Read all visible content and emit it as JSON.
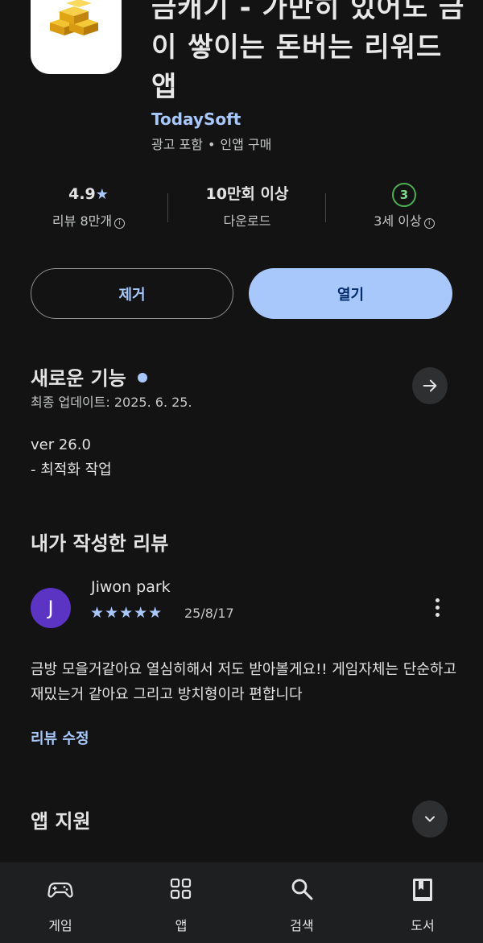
{
  "app": {
    "title": "금캐기 - 가만히 있어도 금이 쌓이는 돈버는 리워드 앱",
    "developer": "TodaySoft",
    "meta_ads": "광고 포함",
    "meta_iap": "인앱 구매"
  },
  "stats": {
    "rating": "4.9",
    "rating_star": "★",
    "reviews": "리뷰 8만개",
    "downloads": "10만회 이상",
    "downloads_label": "다운로드",
    "age_badge": "3",
    "age_label": "3세 이상"
  },
  "actions": {
    "remove_label": "제거",
    "open_label": "열기"
  },
  "whats_new": {
    "title": "새로운 기능",
    "last_updated": "최종 업데이트: 2025. 6. 25.",
    "version": "ver 26.0",
    "note": "- 최적화 작업"
  },
  "my_review": {
    "title": "내가 작성한 리뷰",
    "avatar_initial": "J",
    "reviewer": "Jiwon park",
    "stars": "★★★★★",
    "rating": 5,
    "date": "25/8/17",
    "text": "금방 모을거같아요 열심히해서 저도 받아볼게요!! 게임자체는 단순하고 재밌는거 같아요 그리고 방치형이라 편합니다",
    "edit_label": "리뷰 수정"
  },
  "app_support": {
    "title": "앱 지원"
  },
  "bottom_nav": {
    "games": "게임",
    "apps": "앱",
    "search": "검색",
    "books": "도서"
  },
  "colors": {
    "background": "#131314",
    "accent": "#a8c7fa",
    "avatar": "#5b34c4",
    "nav_bar": "#1e1f20"
  }
}
